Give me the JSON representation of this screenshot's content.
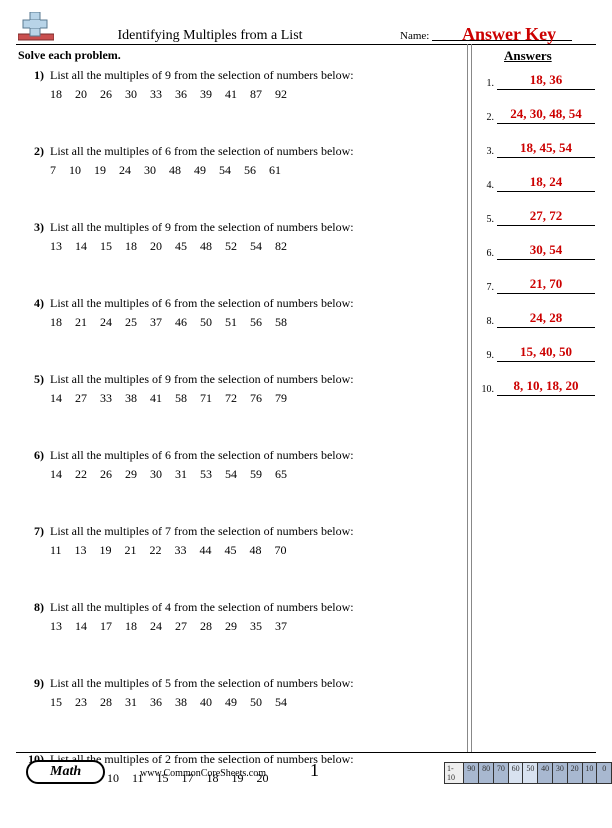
{
  "header": {
    "title": "Identifying Multiples from a List",
    "name_label": "Name:",
    "answer_key": "Answer Key"
  },
  "instruction": "Solve each problem.",
  "answers_header": "Answers",
  "problems": [
    {
      "n": "1)",
      "prompt": "List all the multiples of 9 from the selection of numbers below:",
      "numbers": "18   20   26   30   33   36   39   41   87   92"
    },
    {
      "n": "2)",
      "prompt": "List all the multiples of 6 from the selection of numbers below:",
      "numbers": "7   10   19   24   30   48   49   54   56   61"
    },
    {
      "n": "3)",
      "prompt": "List all the multiples of 9 from the selection of numbers below:",
      "numbers": "13   14   15   18   20   45   48   52   54   82"
    },
    {
      "n": "4)",
      "prompt": "List all the multiples of 6 from the selection of numbers below:",
      "numbers": "18   21   24   25   37   46   50   51   56   58"
    },
    {
      "n": "5)",
      "prompt": "List all the multiples of 9 from the selection of numbers below:",
      "numbers": "14   27   33   38   41   58   71   72   76   79"
    },
    {
      "n": "6)",
      "prompt": "List all the multiples of 6 from the selection of numbers below:",
      "numbers": "14   22   26   29   30   31   53   54   59   65"
    },
    {
      "n": "7)",
      "prompt": "List all the multiples of 7 from the selection of numbers below:",
      "numbers": "11   13   19   21   22   33   44   45   48   70"
    },
    {
      "n": "8)",
      "prompt": "List all the multiples of 4 from the selection of numbers below:",
      "numbers": "13   14   17   18   24   27   28   29   35   37"
    },
    {
      "n": "9)",
      "prompt": "List all the multiples of 5 from the selection of numbers below:",
      "numbers": "15   23   28   31   36   38   40   49   50   54"
    },
    {
      "n": "10)",
      "prompt": "List all the multiples of 2 from the selection of numbers below:",
      "numbers": "5   8   9   10   11   15   17   18   19   20"
    }
  ],
  "answers": [
    {
      "idx": "1.",
      "val": "18, 36"
    },
    {
      "idx": "2.",
      "val": "24, 30, 48, 54"
    },
    {
      "idx": "3.",
      "val": "18, 45, 54"
    },
    {
      "idx": "4.",
      "val": "18, 24"
    },
    {
      "idx": "5.",
      "val": "27, 72"
    },
    {
      "idx": "6.",
      "val": "30, 54"
    },
    {
      "idx": "7.",
      "val": "21, 70"
    },
    {
      "idx": "8.",
      "val": "24, 28"
    },
    {
      "idx": "9.",
      "val": "15, 40, 50"
    },
    {
      "idx": "10.",
      "val": "8, 10, 18, 20"
    }
  ],
  "footer": {
    "subject": "Math",
    "url": "www.CommonCoreSheets.com",
    "page": "1",
    "score_label": "1-10",
    "scores": [
      "90",
      "80",
      "70",
      "60",
      "50",
      "40",
      "30",
      "20",
      "10",
      "0"
    ]
  }
}
